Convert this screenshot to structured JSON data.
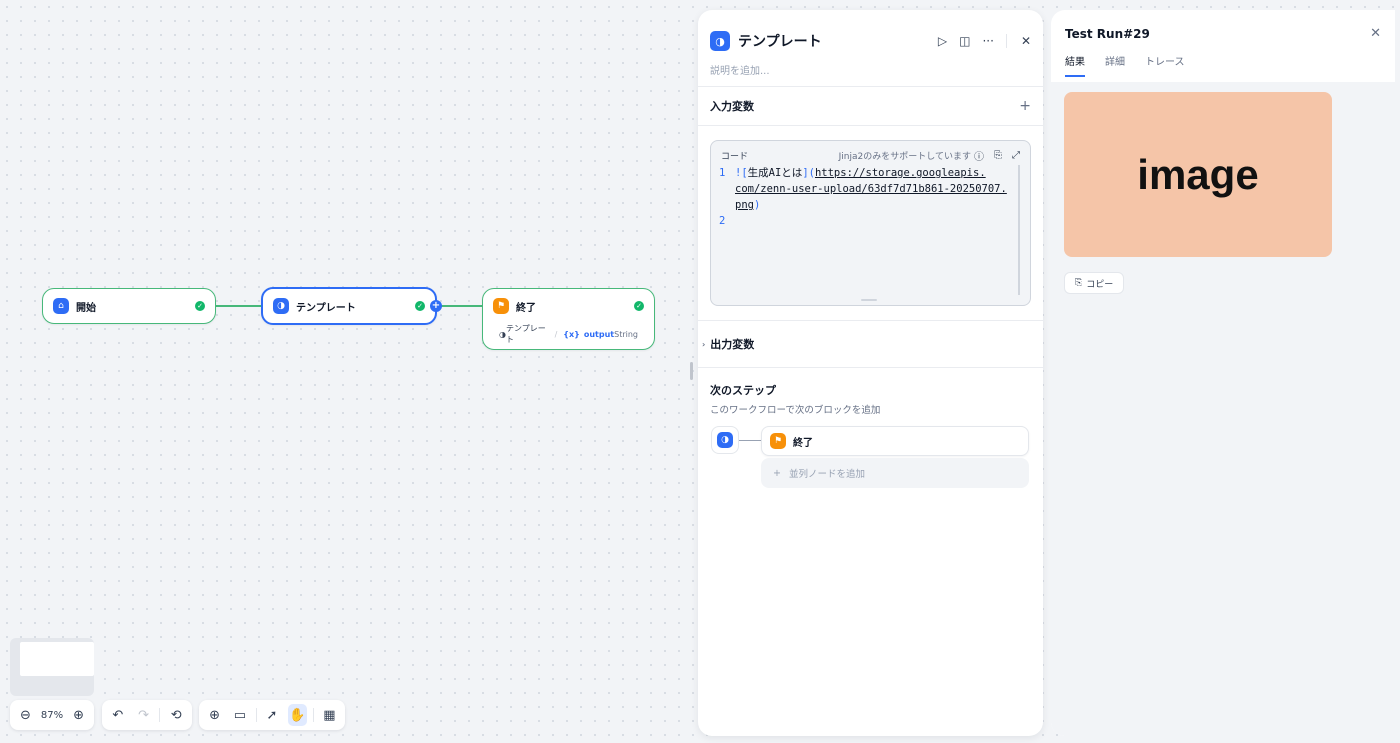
{
  "workflow": {
    "nodes": {
      "start": {
        "title": "開始"
      },
      "template": {
        "title": "テンプレート"
      },
      "end": {
        "title": "終了",
        "output_source": "テンプレート",
        "output_sep": "/",
        "output_var_prefix": "{x}",
        "output_var": "output",
        "output_type": "String"
      }
    }
  },
  "toolbar": {
    "zoom": "87%"
  },
  "panel": {
    "title": "テンプレート",
    "description_placeholder": "説明を追加...",
    "input_vars_label": "入力変数",
    "code": {
      "label": "コード",
      "hint": "Jinja2のみをサポートしています",
      "lines": [
        {
          "num": "1",
          "seg1": "![",
          "seg2": "生成AIとは",
          "seg3": "](",
          "url1": "https://storage.googleapis.",
          "url2": "com/zenn-user-upload/63df7d71b861-20250707.",
          "url3": "png",
          "seg4": ")"
        },
        {
          "num": "2"
        }
      ]
    },
    "output_vars_label": "出力変数",
    "next_step": {
      "title": "次のステップ",
      "subtitle": "このワークフローで次のブロックを追加",
      "node_label": "終了",
      "add_parallel": "並列ノードを追加"
    }
  },
  "run": {
    "title": "Test Run#29",
    "tabs": [
      "結果",
      "詳細",
      "トレース"
    ],
    "image_text": "image",
    "copy_label": "コピー"
  },
  "colors": {
    "accent": "#2e6cf5",
    "success": "#12b76a",
    "edge": "#47b87a",
    "end_icon": "#f79009",
    "image_bg": "#f5c5a8"
  }
}
